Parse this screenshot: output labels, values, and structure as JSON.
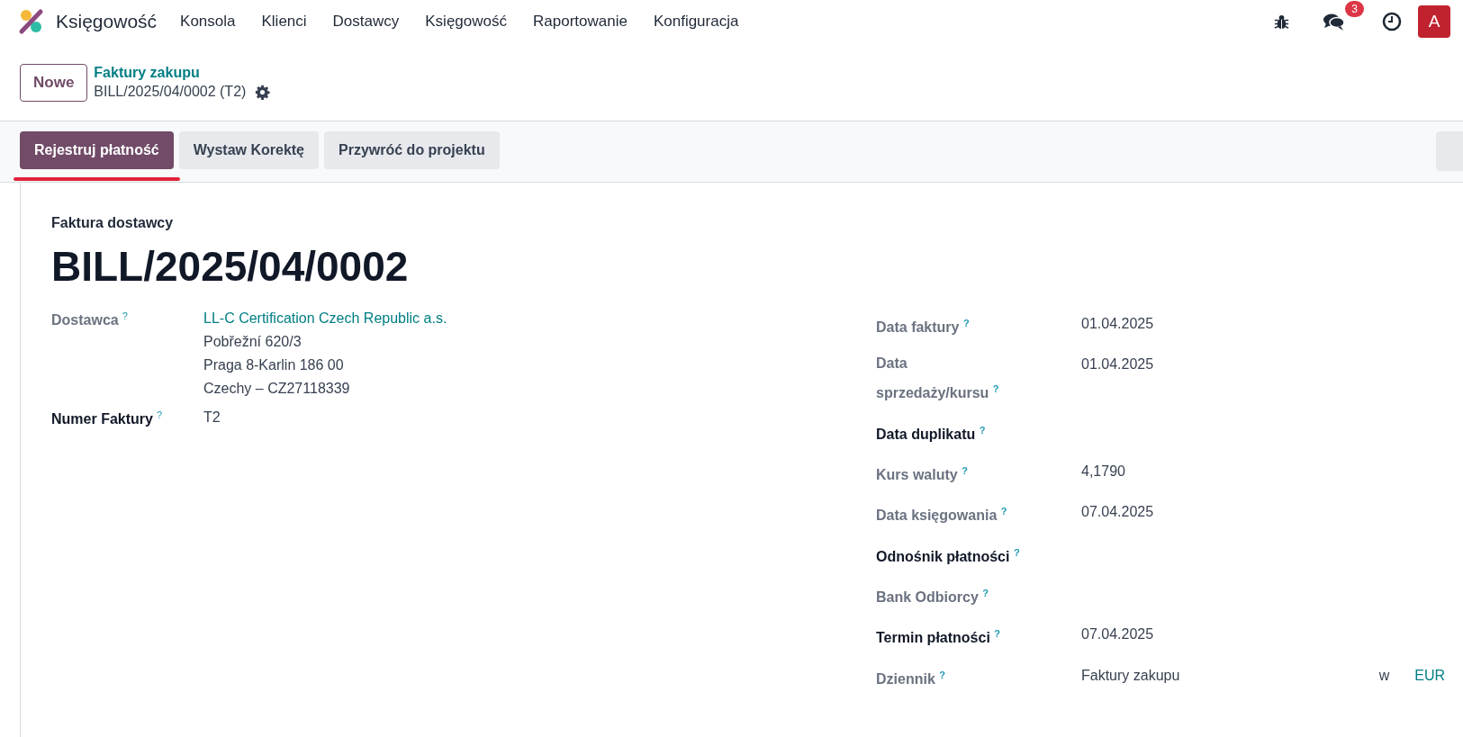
{
  "navbar": {
    "app_name": "Księgowość",
    "menu": [
      "Konsola",
      "Klienci",
      "Dostawcy",
      "Księgowość",
      "Raportowanie",
      "Konfiguracja"
    ],
    "message_count": "3",
    "avatar_letter": "A"
  },
  "control_panel": {
    "new_button": "Nowe",
    "breadcrumb": "Faktury zakupu",
    "record": "BILL/2025/04/0002 (T2)"
  },
  "toolbar": {
    "buttons": [
      {
        "label": "Rejestruj płatność",
        "kind": "primary",
        "highlighted": true
      },
      {
        "label": "Wystaw Korektę",
        "kind": "secondary",
        "highlighted": false
      },
      {
        "label": "Przywróć do projektu",
        "kind": "secondary",
        "highlighted": false
      }
    ]
  },
  "form": {
    "type_label": "Faktura dostawcy",
    "name": "BILL/2025/04/0002",
    "left_fields": [
      {
        "label": "Dostawca",
        "help": "?",
        "required": false,
        "values": [
          {
            "text": "LL-C Certification Czech Republic a.s.",
            "kind": "link"
          },
          {
            "text": "Pobřežní 620/3",
            "kind": "text"
          },
          {
            "text": "Praga 8-Karlin 186 00",
            "kind": "text"
          },
          {
            "text": "Czechy – CZ27118339",
            "kind": "text"
          }
        ]
      },
      {
        "label": "Numer Faktury",
        "help": "?",
        "required": true,
        "values": [
          {
            "text": "T2",
            "kind": "text"
          }
        ]
      }
    ],
    "right_fields": [
      {
        "label": "Data faktury",
        "help": "?",
        "required": false,
        "values": [
          {
            "text": "01.04.2025",
            "kind": "text"
          }
        ]
      },
      {
        "label": "Data sprzedaży/kursu",
        "help": "?",
        "required": false,
        "values": [
          {
            "text": "01.04.2025",
            "kind": "text"
          }
        ]
      },
      {
        "label": "Data duplikatu",
        "help": "?",
        "required": true
      },
      {
        "label": "Kurs waluty",
        "help": "?",
        "required": false,
        "values": [
          {
            "text": "4,1790",
            "kind": "text"
          }
        ]
      },
      {
        "label": "Data księgowania",
        "help": "?",
        "required": false,
        "values": [
          {
            "text": "07.04.2025",
            "kind": "text"
          }
        ]
      },
      {
        "label": "Odnośnik płatności",
        "help": "?",
        "required": true
      },
      {
        "label": "Bank Odbiorcy",
        "help": "?",
        "required": false
      },
      {
        "label": "Termin płatności",
        "help": "?",
        "required": true,
        "values": [
          {
            "text": "07.04.2025",
            "kind": "text"
          }
        ]
      },
      {
        "label": "Dziennik",
        "help": "?",
        "required": false,
        "values": [
          {
            "text": "Faktury zakupu",
            "kind": "text"
          }
        ],
        "suffix": "w",
        "currency": "EUR"
      }
    ]
  }
}
